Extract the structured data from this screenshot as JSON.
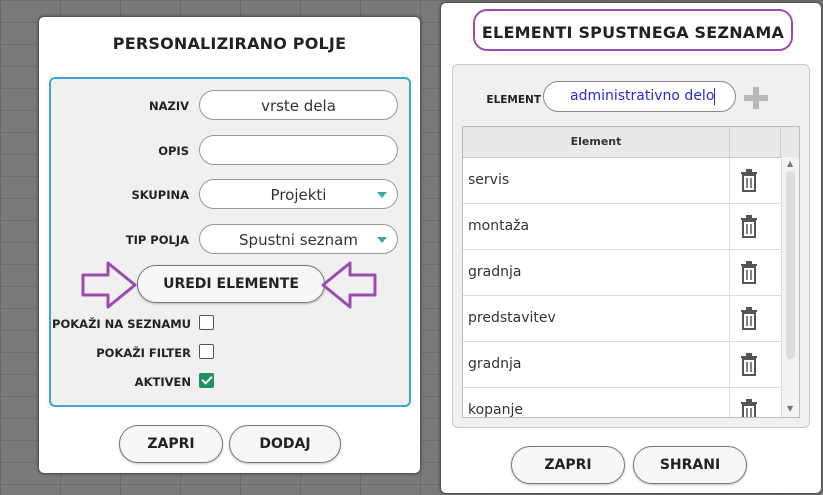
{
  "left_dialog": {
    "title": "PERSONALIZIRANO POLJE",
    "fields": {
      "naziv_label": "NAZIV",
      "naziv_value": "vrste dela",
      "opis_label": "OPIS",
      "opis_value": "",
      "skupina_label": "SKUPINA",
      "skupina_value": "Projekti",
      "tip_label": "TIP POLJA",
      "tip_value": "Spustni seznam"
    },
    "edit_button": "UREDI ELEMENTE",
    "checkboxes": [
      {
        "label": "POKAŽI NA SEZNAMU",
        "checked": false
      },
      {
        "label": "POKAŽI FILTER",
        "checked": false
      },
      {
        "label": "AKTIVEN",
        "checked": true
      }
    ],
    "close_button": "ZAPRI",
    "add_button": "DODAJ"
  },
  "right_dialog": {
    "title": "ELEMENTI SPUSTNEGA SEZNAMA",
    "element_label": "ELEMENT",
    "element_input_value": "administrativno delo",
    "table_header": "Element",
    "rows": [
      "servis",
      "montaža",
      "gradnja",
      "predstavitev",
      "gradnja",
      "kopanje"
    ],
    "close_button": "ZAPRI",
    "save_button": "SHRANI"
  },
  "colors": {
    "accent_border": "#3aa6d8",
    "annotation_purple": "#9b4bb0",
    "checkbox_checked": "#1f9160",
    "input_text_blue": "#2a2ad0",
    "caret_teal": "#3aa8a8"
  }
}
